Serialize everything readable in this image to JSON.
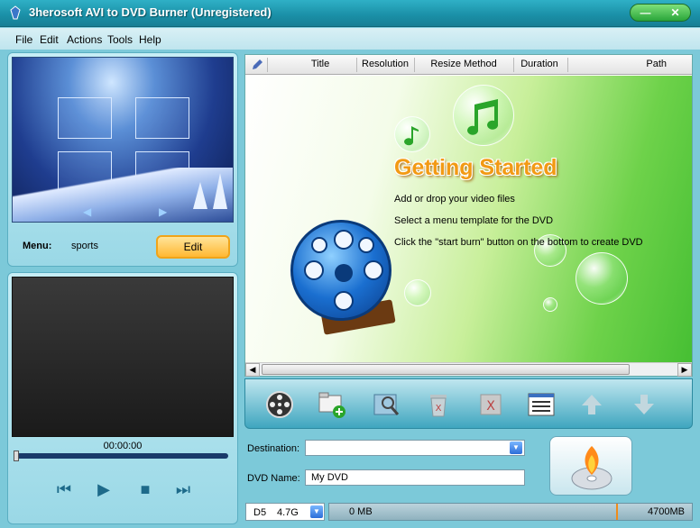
{
  "window": {
    "title": "3herosoft AVI to DVD Burner (Unregistered)",
    "min": "—",
    "close": "✕"
  },
  "menubar": {
    "items": [
      "File",
      "Edit",
      "Actions",
      "Tools",
      "Help"
    ]
  },
  "menu_panel": {
    "label": "Menu:",
    "value": "sports",
    "edit_label": "Edit"
  },
  "player": {
    "time": "00:00:00",
    "seek_fraction": 0.0
  },
  "list": {
    "columns": [
      "Title",
      "Resolution",
      "Resize Method",
      "Duration",
      "Path"
    ],
    "getting_started": {
      "title": "Getting Started",
      "lines": [
        "Add or drop your video files",
        "Select a menu template for the DVD",
        "Click the \"start burn\" button on the bottom to create DVD"
      ]
    }
  },
  "form": {
    "destination_label": "Destination:",
    "destination_value": "",
    "dvd_name_label": "DVD Name:",
    "dvd_name_value": "My DVD"
  },
  "disc": {
    "type": "D5",
    "size": "4.7G",
    "used": "0 MB",
    "capacity": "4700MB"
  },
  "colors": {
    "accent": "#f29a14",
    "title_bar": "#1a8fa6",
    "toolbar": "#3fa6bf"
  }
}
